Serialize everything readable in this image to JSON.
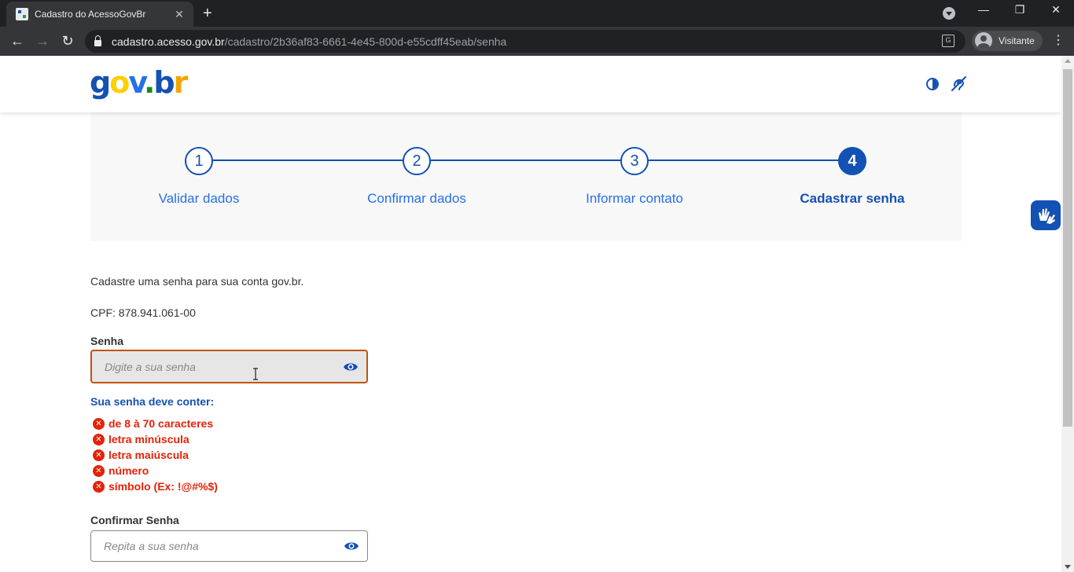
{
  "browser": {
    "tab_title": "Cadastro do AcessoGovBr",
    "tab_close": "✕",
    "new_tab": "+",
    "url_host": "cadastro.acesso.gov.br",
    "url_path": "/cadastro/2b36af83-6661-4e45-800d-e55cdff45eab/senha",
    "profile_label": "Visitante",
    "back": "←",
    "forward": "→",
    "reload": "↻",
    "menu": "⋮",
    "minimize": "—",
    "maximize": "❐",
    "close": "✕",
    "translate": "G"
  },
  "header": {
    "logo": {
      "g": "g",
      "o": "o",
      "v": "v",
      "dot": ".",
      "b": "b",
      "r": "r"
    },
    "colors": {
      "primary": "#1351b4",
      "yellow": "#fdd000",
      "green": "#168821"
    }
  },
  "stepper": {
    "steps": [
      {
        "number": "1",
        "label": "Validar dados"
      },
      {
        "number": "2",
        "label": "Confirmar dados"
      },
      {
        "number": "3",
        "label": "Informar contato"
      },
      {
        "number": "4",
        "label": "Cadastrar senha"
      }
    ],
    "active_step": 4
  },
  "form": {
    "intro": "Cadastre uma senha para sua conta gov.br.",
    "cpf": "CPF: 878.941.061-00",
    "password_label": "Senha",
    "password_placeholder": "Digite a sua senha",
    "requirements_title": "Sua senha deve conter:",
    "requirements": [
      "de 8 à 70 caracteres",
      "letra minúscula",
      "letra maiúscula",
      "número",
      "símbolo (Ex: !@#%$)"
    ],
    "confirm_label": "Confirmar Senha",
    "confirm_placeholder": "Repita a sua senha",
    "error_color": "#e52207",
    "focus_border_color": "#c2530a"
  }
}
